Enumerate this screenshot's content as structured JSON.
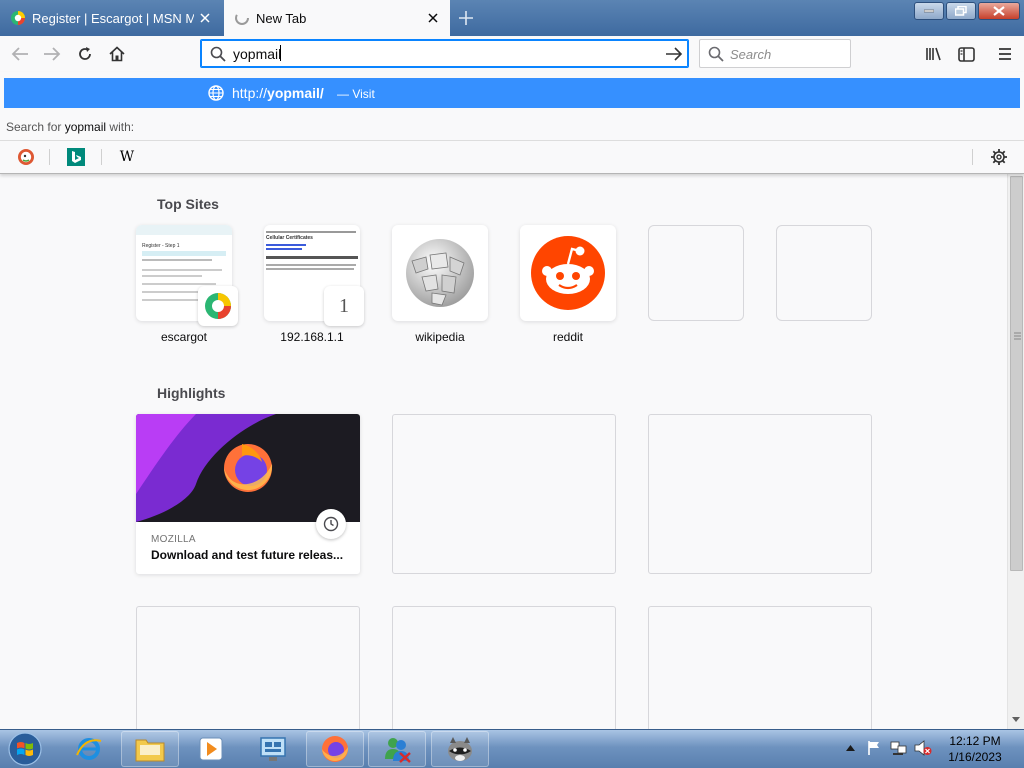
{
  "tabs": [
    {
      "title": "Register | Escargot | MSN Messenger",
      "active": false
    },
    {
      "title": "New Tab",
      "active": true
    }
  ],
  "urlbar": {
    "value": "yopmail"
  },
  "searchbar": {
    "placeholder": "Search"
  },
  "popup": {
    "result_scheme": "http://",
    "result_host": "yopmail/",
    "result_action": "— Visit",
    "search_prefix": "Search for",
    "search_term": "yopmail",
    "search_suffix": "with:",
    "engines": [
      "duckduckgo-icon",
      "bing-icon",
      "wikipedia-icon"
    ],
    "engine_wiki_letter": "W"
  },
  "top_sites": {
    "title": "Top Sites",
    "items": [
      {
        "label": "escargot",
        "thumb_heading": "Register - Step 1"
      },
      {
        "label": "192.168.1.1",
        "badge": "1",
        "thumb_heading": "Cellular Certificates"
      },
      {
        "label": "wikipedia"
      },
      {
        "label": "reddit"
      }
    ]
  },
  "highlights": {
    "title": "Highlights",
    "items": [
      {
        "source": "MOZILLA",
        "title": "Download and test future releas..."
      }
    ]
  },
  "taskbar": {
    "time": "12:12 PM",
    "date": "1/16/2023"
  },
  "colors": {
    "accent": "#0a84ff",
    "popup_highlight": "#3690ff",
    "reddit": "#ff4500"
  }
}
